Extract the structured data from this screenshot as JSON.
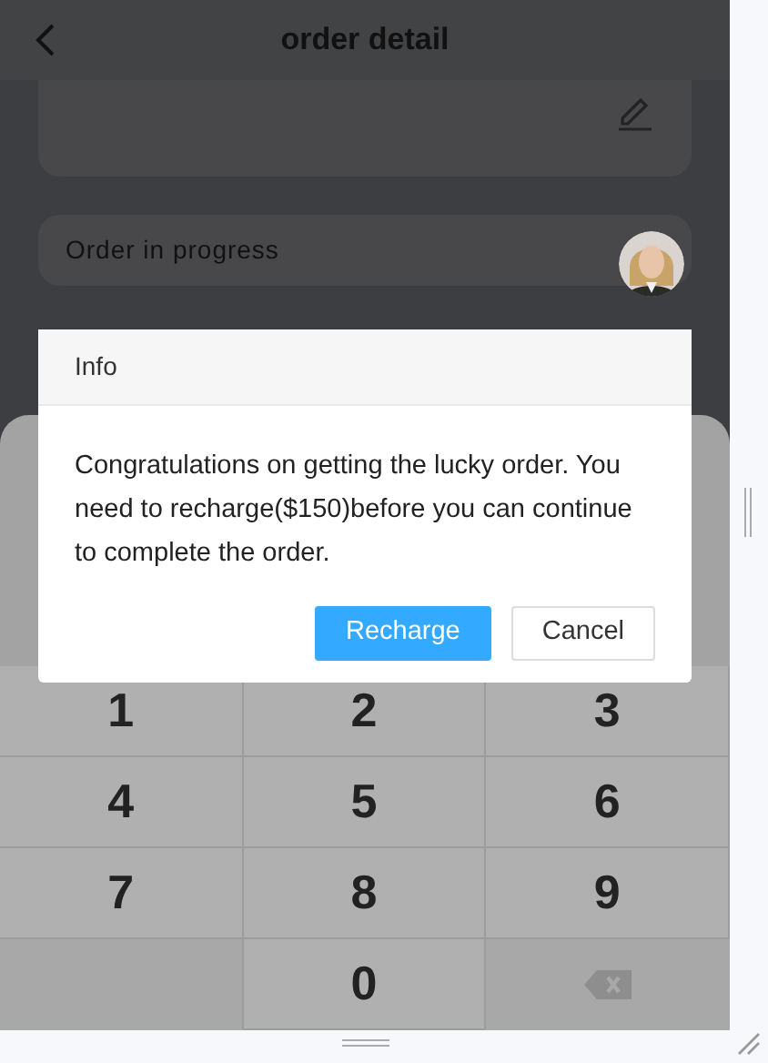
{
  "header": {
    "title": "order detail"
  },
  "order_status": {
    "label": "Order in progress"
  },
  "dialog": {
    "title": "Info",
    "message": "Congratulations on getting the lucky order. You need to recharge($150)before you can continue to complete the order.",
    "buttons": [
      {
        "label": "Recharge",
        "kind": "primary"
      },
      {
        "label": "Cancel",
        "kind": "secondary"
      }
    ]
  },
  "keys": [
    {
      "kind": "digit",
      "label": "1"
    },
    {
      "kind": "digit",
      "label": "2"
    },
    {
      "kind": "digit",
      "label": "3"
    },
    {
      "kind": "digit",
      "label": "4"
    },
    {
      "kind": "digit",
      "label": "5"
    },
    {
      "kind": "digit",
      "label": "6"
    },
    {
      "kind": "digit",
      "label": "7"
    },
    {
      "kind": "digit",
      "label": "8"
    },
    {
      "kind": "digit",
      "label": "9"
    },
    {
      "kind": "blank"
    },
    {
      "kind": "digit",
      "label": "0"
    },
    {
      "kind": "backspace"
    }
  ]
}
